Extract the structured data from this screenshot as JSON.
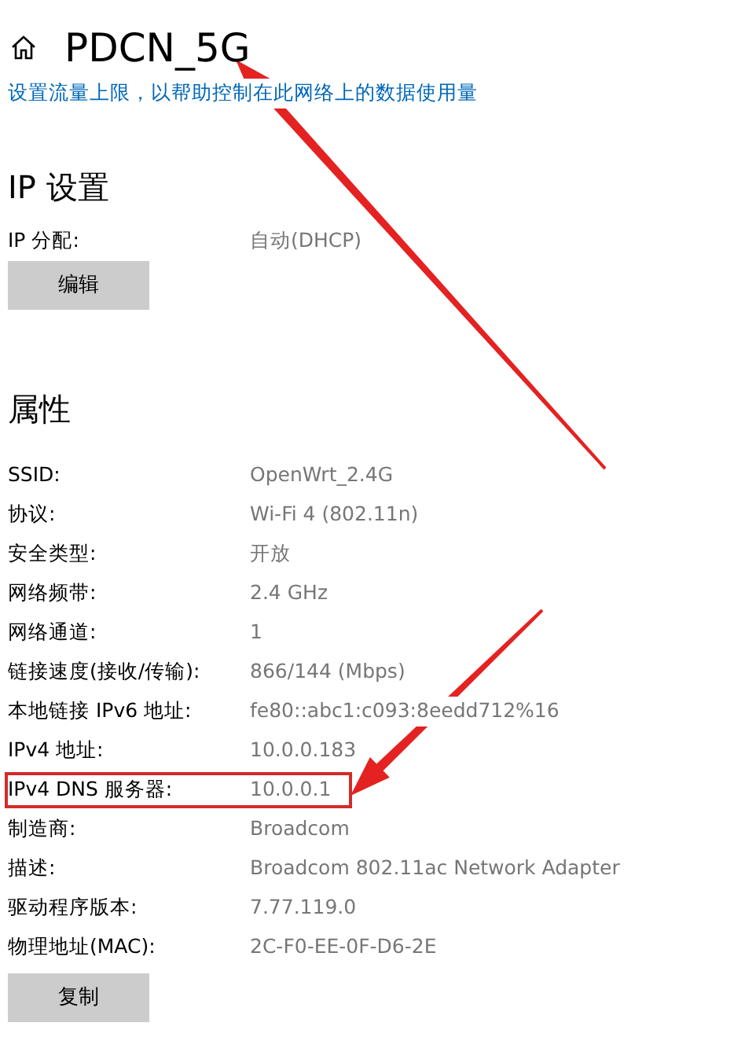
{
  "header": {
    "title": "PDCN_5G",
    "link": "设置流量上限，以帮助控制在此网络上的数据使用量"
  },
  "ip_settings": {
    "heading": "IP 设置",
    "rows": [
      {
        "label": "IP 分配:",
        "value": "自动(DHCP)"
      }
    ],
    "button": "编辑"
  },
  "properties": {
    "heading": "属性",
    "rows": [
      {
        "label": "SSID:",
        "value": "OpenWrt_2.4G",
        "highlighted": false
      },
      {
        "label": "协议:",
        "value": "Wi-Fi 4 (802.11n)",
        "highlighted": false
      },
      {
        "label": "安全类型:",
        "value": "开放",
        "highlighted": false
      },
      {
        "label": "网络频带:",
        "value": "2.4 GHz",
        "highlighted": false
      },
      {
        "label": "网络通道:",
        "value": "1",
        "highlighted": false
      },
      {
        "label": "链接速度(接收/传输):",
        "value": "866/144 (Mbps)",
        "highlighted": false
      },
      {
        "label": "本地链接 IPv6 地址:",
        "value": "fe80::abc1:c093:8eedd712%16",
        "highlighted": false
      },
      {
        "label": "IPv4 地址:",
        "value": "10.0.0.183",
        "highlighted": false
      },
      {
        "label": "IPv4 DNS 服务器:",
        "value": "10.0.0.1",
        "highlighted": true
      },
      {
        "label": "制造商:",
        "value": "Broadcom",
        "highlighted": false
      },
      {
        "label": "描述:",
        "value": "Broadcom 802.11ac Network Adapter",
        "highlighted": false
      },
      {
        "label": "驱动程序版本:",
        "value": "7.77.119.0",
        "highlighted": false
      },
      {
        "label": "物理地址(MAC):",
        "value": "2C-F0-EE-0F-D6-2E",
        "highlighted": false
      }
    ],
    "button": "复制"
  },
  "annotations": [
    {
      "kind": "arrow"
    },
    {
      "kind": "arrow"
    }
  ]
}
